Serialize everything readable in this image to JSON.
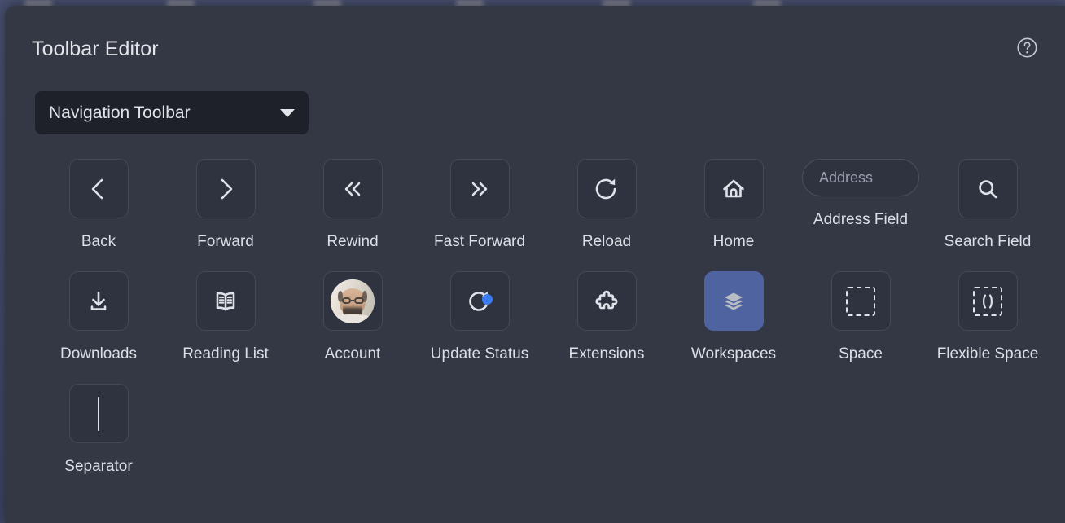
{
  "window": {
    "title": "Toolbar Editor",
    "help_icon": "help-circle-icon"
  },
  "toolbar_select": {
    "value": "Navigation Toolbar",
    "caret_icon": "chevron-down-icon",
    "options": [
      "Navigation Toolbar"
    ]
  },
  "palette": {
    "items": [
      {
        "label": "Back",
        "icon": "chevron-left-icon"
      },
      {
        "label": "Forward",
        "icon": "chevron-right-icon"
      },
      {
        "label": "Rewind",
        "icon": "double-chevron-left-icon"
      },
      {
        "label": "Fast Forward",
        "icon": "double-chevron-right-icon"
      },
      {
        "label": "Reload",
        "icon": "reload-circular-arrow-icon"
      },
      {
        "label": "Home",
        "icon": "home-house-icon"
      },
      {
        "label": "Address Field",
        "icon": "address-field-input",
        "placeholder": "Address"
      },
      {
        "label": "Search Field",
        "icon": "magnifying-glass-icon"
      },
      {
        "label": "Downloads",
        "icon": "download-arrow-tray-icon"
      },
      {
        "label": "Reading List",
        "icon": "open-book-icon"
      },
      {
        "label": "Account",
        "icon": "user-avatar-photo"
      },
      {
        "label": "Update Status",
        "icon": "update-refresh-arrow-icon"
      },
      {
        "label": "Extensions",
        "icon": "puzzle-piece-icon"
      },
      {
        "label": "Workspaces",
        "icon": "stacked-layers-icon"
      },
      {
        "label": "Space",
        "icon": "dashed-square-icon"
      },
      {
        "label": "Flexible Space",
        "icon": "dashed-square-parentheses-icon"
      },
      {
        "label": "Separator",
        "icon": "vertical-bar-icon"
      }
    ]
  },
  "colors": {
    "sheet_background": "#343845",
    "tile_background": "#2f3340",
    "tile_border": "#44485a",
    "select_background": "#1f212a",
    "text_primary": "#e3e5ea",
    "text_secondary": "#9a9ead",
    "accent_workspaces": "#4e63a0",
    "badge_blue": "#3b7cf0",
    "backdrop": "#414865"
  }
}
